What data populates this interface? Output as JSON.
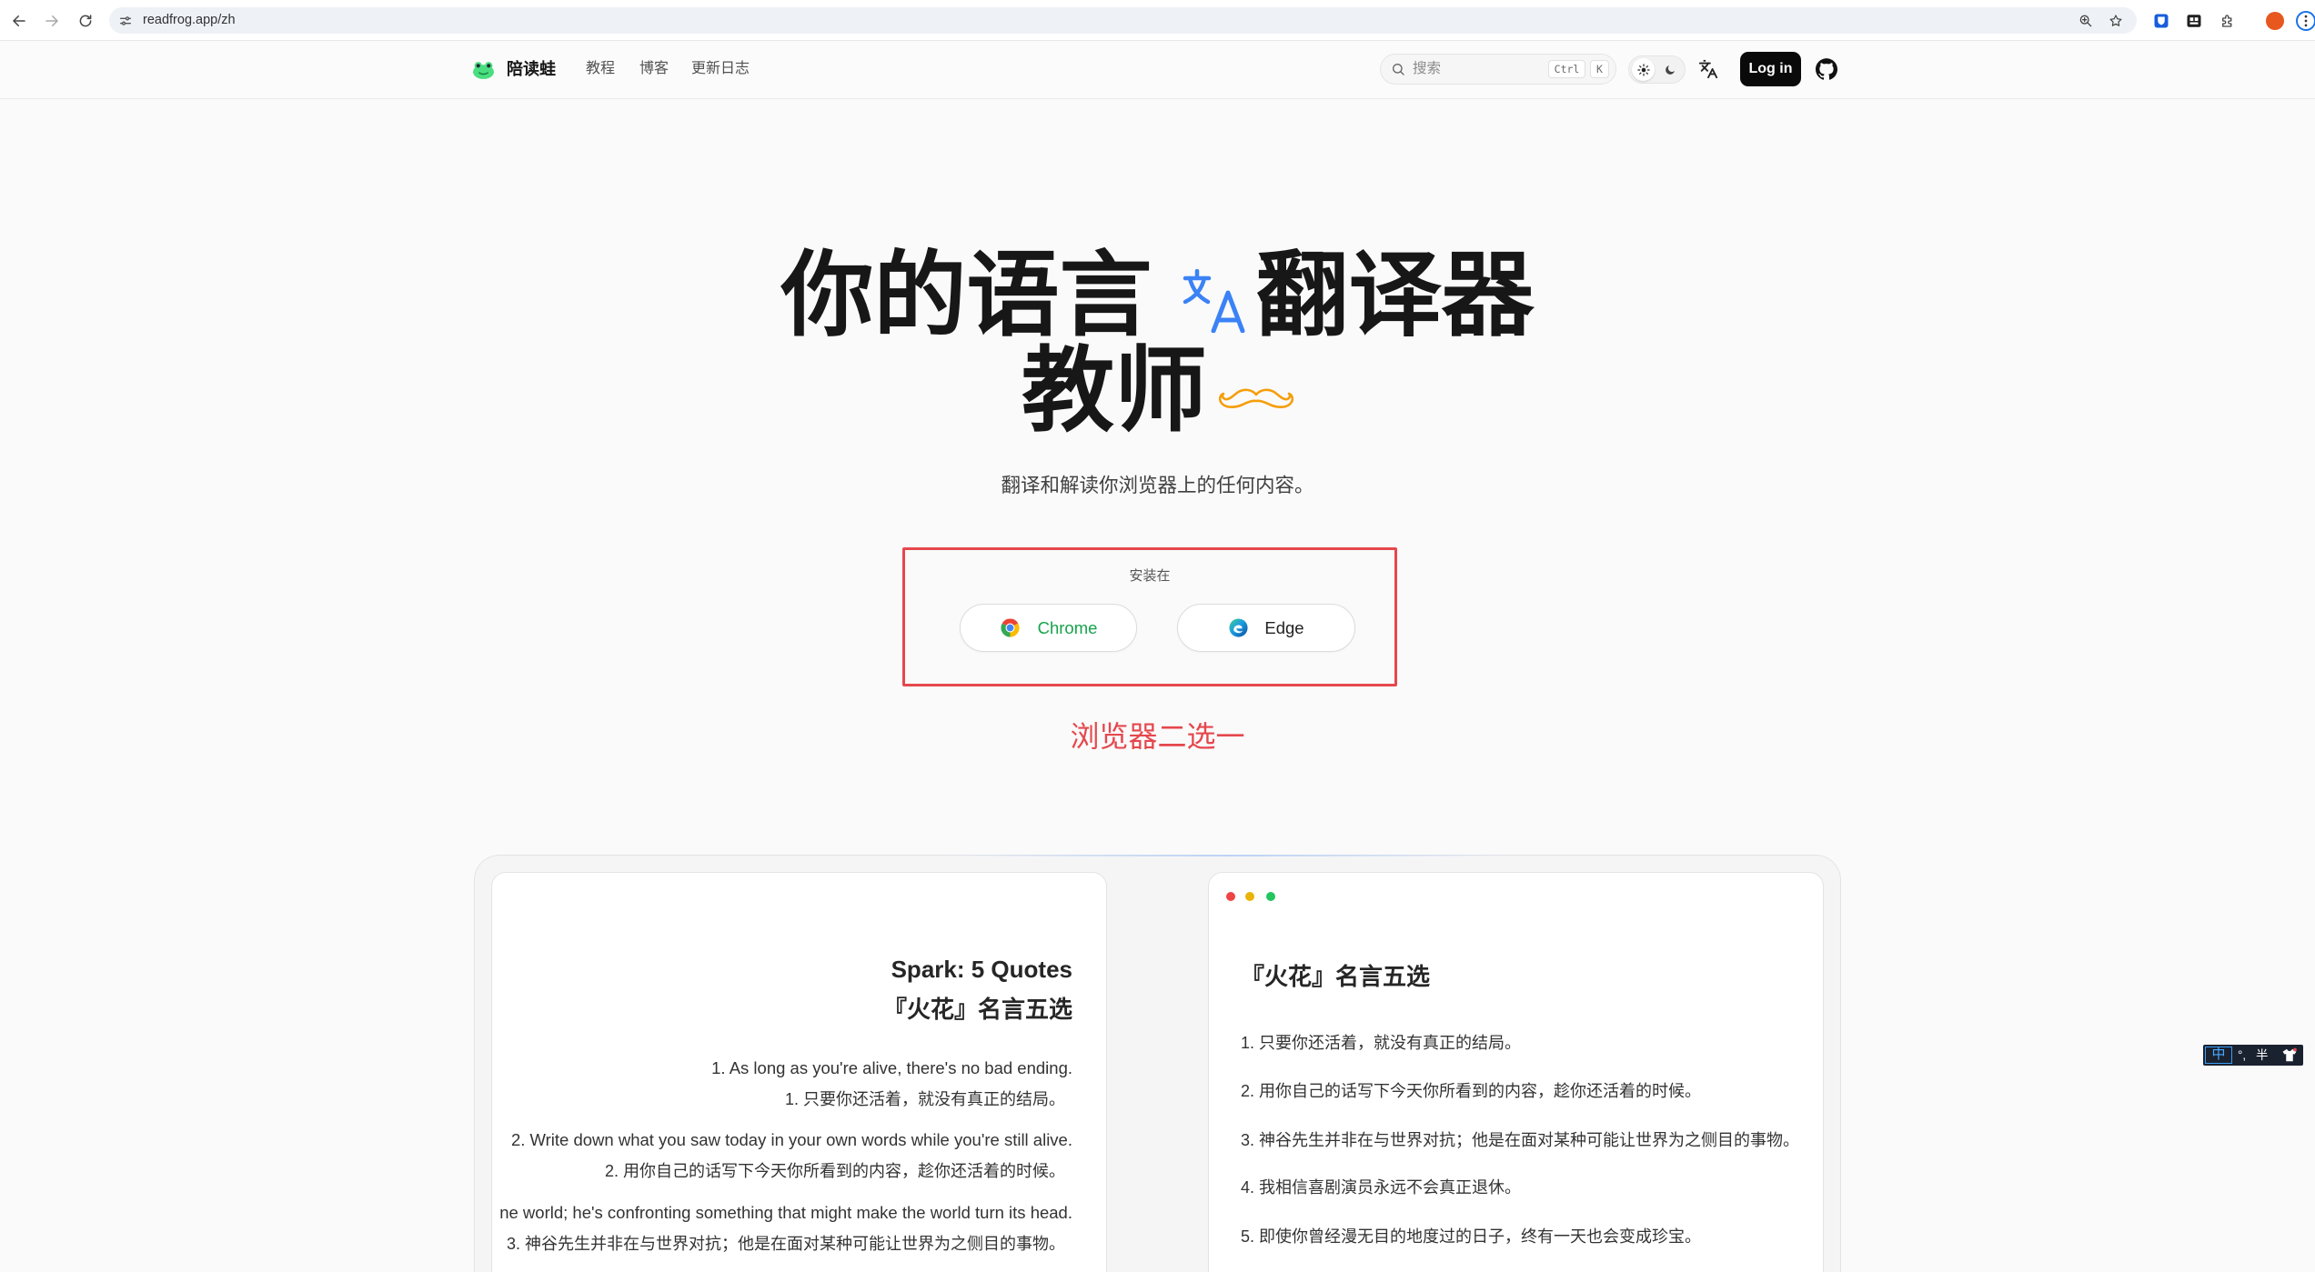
{
  "browser": {
    "url": "readfrog.app/zh"
  },
  "nav": {
    "brand": "陪读蛙",
    "links": [
      "教程",
      "博客",
      "更新日志"
    ],
    "search": {
      "placeholder": "搜索",
      "shortcut_keys": [
        "Ctrl",
        "K"
      ]
    },
    "login_label": "Log in"
  },
  "hero": {
    "title_line1_before_icon": "你的语言",
    "title_line1_after_icon": "翻译器",
    "title_line2": "教师",
    "subtitle": "翻译和解读你浏览器上的任何内容。"
  },
  "install": {
    "label": "安装在",
    "browsers": [
      {
        "name": "Chrome",
        "icon": "chrome-logo-icon"
      },
      {
        "name": "Edge",
        "icon": "edge-logo-icon"
      }
    ]
  },
  "annotation": {
    "text": "浏览器二选一"
  },
  "demo": {
    "original": {
      "title_en": "Spark: 5 Quotes",
      "title_zh": "『火花』名言五选",
      "lines": [
        {
          "en": "1. As long as you're alive, there's no bad ending.",
          "zh": "1. 只要你还活着，就没有真正的结局。"
        },
        {
          "en": "2. Write down what you saw today in your own words while you're still alive.",
          "zh": "2. 用你自己的话写下今天你所看到的内容，趁你还活着的时候。"
        },
        {
          "en": "ne world; he's confronting something that might make the world turn its head.",
          "zh": "3. 神谷先生并非在与世界对抗；他是在面对某种可能让世界为之侧目的事物。"
        }
      ]
    },
    "translated": {
      "title": "『火花』名言五选",
      "items": [
        "1. 只要你还活着，就没有真正的结局。",
        "2. 用你自己的话写下今天你所看到的内容，趁你还活着的时候。",
        "3. 神谷先生并非在与世界对抗；他是在面对某种可能让世界为之侧目的事物。",
        "4. 我相信喜剧演员永远不会真正退休。",
        "5. 即使你曾经漫无目的地度过的日子，终有一天也会变成珍宝。"
      ]
    }
  },
  "ime": {
    "mode": "中",
    "punctuation": "°,",
    "width": "半"
  },
  "icons": [
    "back-icon",
    "forward-icon",
    "reload-icon",
    "site-settings-icon",
    "zoom-icon",
    "star-icon",
    "bitwarden-icon",
    "extension-icon",
    "puzzle-icon",
    "profile-avatar",
    "menu-icon",
    "frog-logo-icon",
    "search-icon",
    "sun-icon",
    "moon-icon",
    "languages-icon",
    "github-icon",
    "mustache-icon"
  ],
  "colors": {
    "text_primary": "#171717",
    "translate_icon": "#3b82f6",
    "mustache": "#f59e0b",
    "chrome_label": "#16a34a",
    "annotation_red": "#e5484d",
    "login_bg": "#0a0a0a"
  }
}
